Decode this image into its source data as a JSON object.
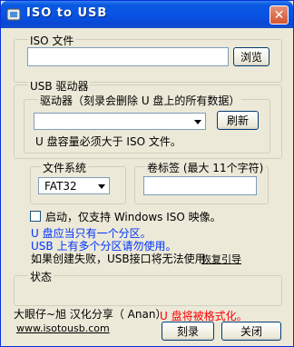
{
  "window": {
    "title": "ISO to USB",
    "close_label": "✕"
  },
  "iso_section": {
    "label": "ISO 文件",
    "path_value": "",
    "browse_label": "浏览"
  },
  "usb_section": {
    "label": "USB 驱动器",
    "drive_label": "驱动器（刻录会删除 U 盘上的所有数据）",
    "drive_value": "",
    "refresh_label": "刷新",
    "capacity_note": "U 盘容量必须大于 ISO 文件。"
  },
  "filesystem": {
    "label": "文件系统",
    "value": "FAT32"
  },
  "volume": {
    "label": "卷标签 (最大 11个字符)",
    "value": ""
  },
  "boot_option": {
    "label": "启动，仅支持 Windows ISO 映像。",
    "checked": false
  },
  "notes": {
    "line1": "U 盘应当只有一个分区。",
    "line2": "USB 上有多个分区请勿使用。",
    "line3": "如果创建失败，USB接口将无法使用",
    "restore_link": "恢复引导"
  },
  "status": {
    "label": "状态",
    "value": ""
  },
  "footer": {
    "credit": "大眼仔~旭 汉化分享（ Anan）",
    "website": "www.isotousb.com",
    "warning": "U 盘将被格式化。",
    "burn_label": "刻录",
    "close_label": "关闭"
  },
  "colors": {
    "title_bar": "#0954e5",
    "note_blue": "#0033ff",
    "warning_red": "#ff0000",
    "face": "#ece9d8"
  }
}
